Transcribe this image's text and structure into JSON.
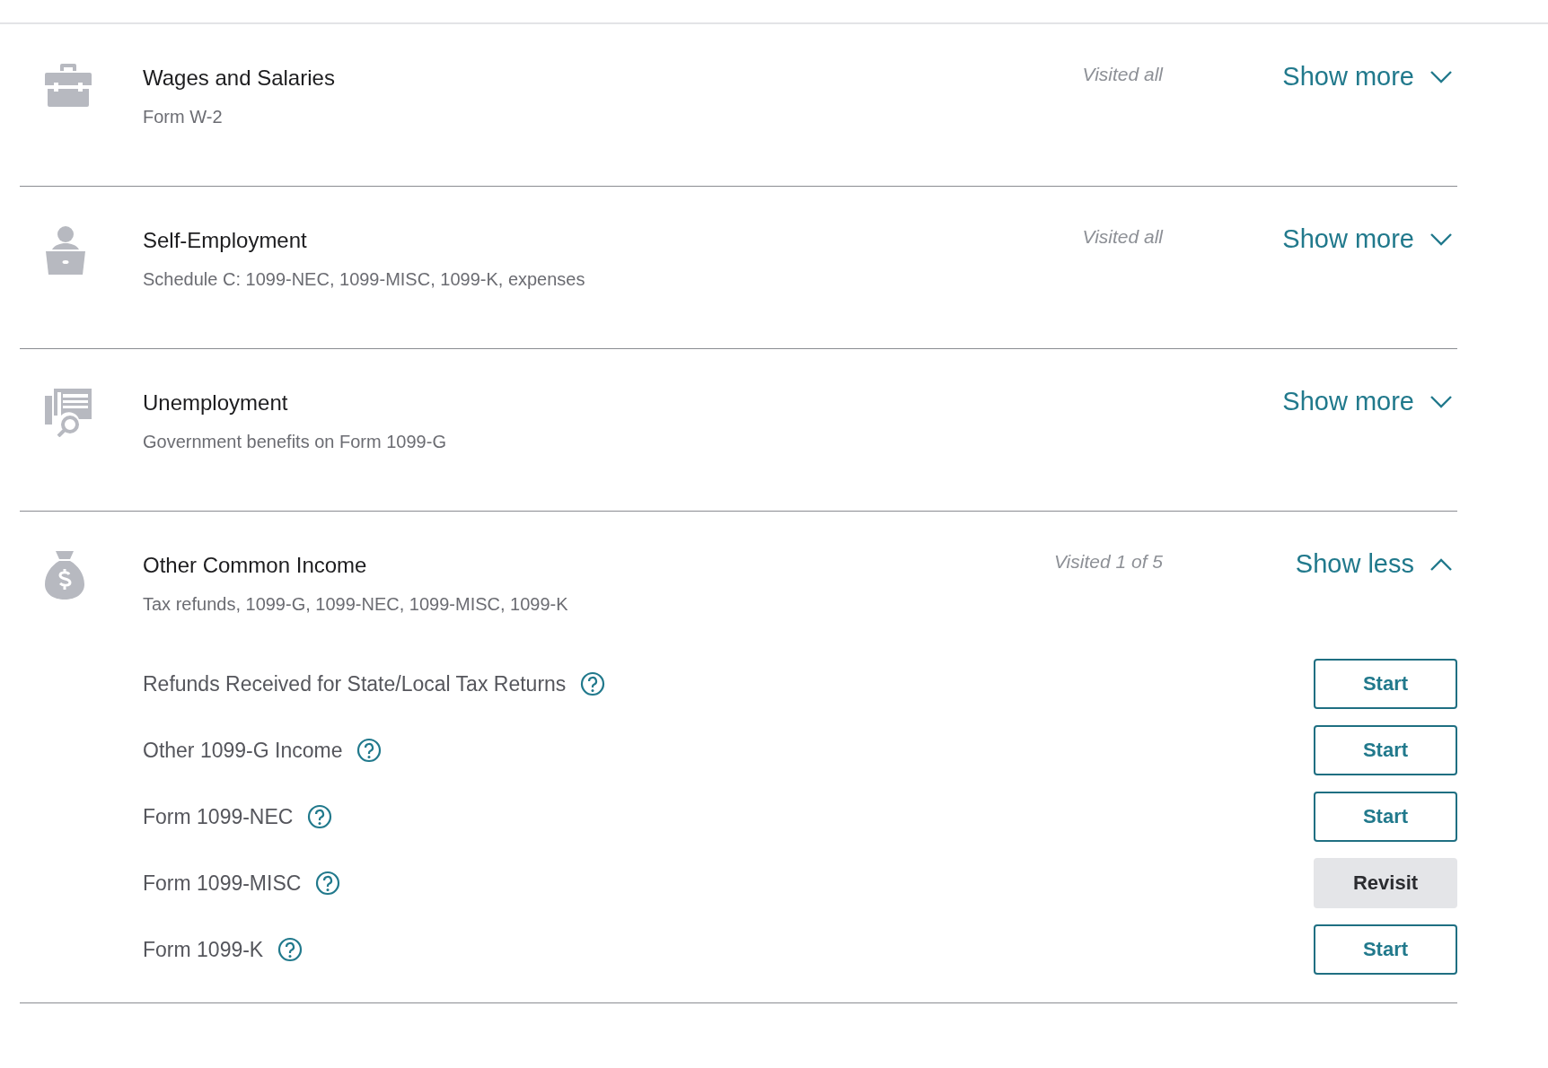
{
  "sections": [
    {
      "title": "Wages and Salaries",
      "subtitle": "Form W-2",
      "status": "Visited all",
      "toggle": "Show more",
      "expanded": false
    },
    {
      "title": "Self-Employment",
      "subtitle": "Schedule C: 1099-NEC, 1099-MISC, 1099-K, expenses",
      "status": "Visited all",
      "toggle": "Show more",
      "expanded": false
    },
    {
      "title": "Unemployment",
      "subtitle": "Government benefits on Form 1099-G",
      "toggle": "Show more",
      "expanded": false
    },
    {
      "title": "Other Common Income",
      "subtitle": "Tax refunds, 1099-G, 1099-NEC, 1099-MISC, 1099-K",
      "status": "Visited 1 of 5",
      "toggle": "Show less",
      "expanded": true,
      "items": [
        {
          "label": "Refunds Received for State/Local Tax Returns",
          "button": "Start",
          "kind": "start"
        },
        {
          "label": "Other 1099-G Income",
          "button": "Start",
          "kind": "start"
        },
        {
          "label": "Form 1099-NEC",
          "button": "Start",
          "kind": "start"
        },
        {
          "label": "Form 1099-MISC",
          "button": "Revisit",
          "kind": "revisit"
        },
        {
          "label": "Form 1099-K",
          "button": "Start",
          "kind": "start"
        }
      ]
    }
  ]
}
